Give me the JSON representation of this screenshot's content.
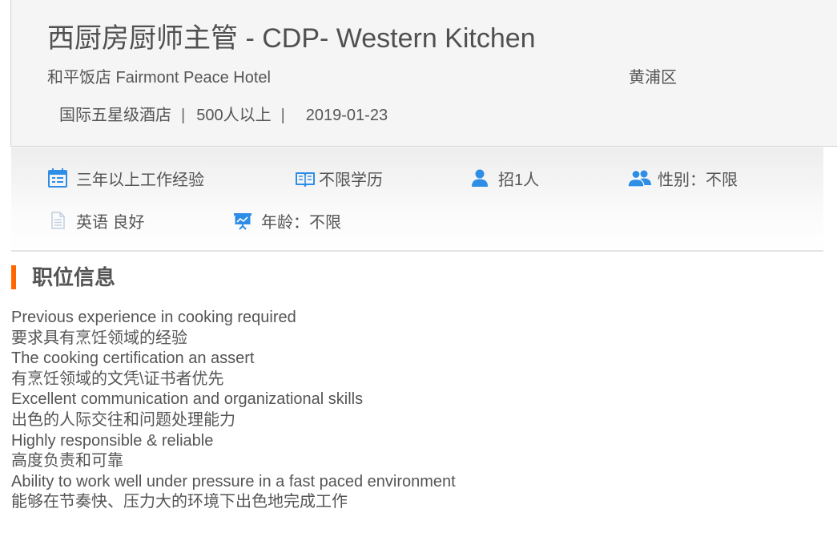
{
  "job": {
    "title": "西厨房厨师主管 - CDP- Western Kitchen",
    "company": "和平饭店 Fairmont Peace Hotel",
    "district": "黄浦区",
    "company_type": "国际五星级酒店",
    "company_size": "500人以上",
    "post_date": "2019-01-23",
    "separator": "|"
  },
  "requirements": [
    {
      "icon": "calendar-icon",
      "text": "三年以上工作经验"
    },
    {
      "icon": "book-icon",
      "text": "不限学历"
    },
    {
      "icon": "person-icon",
      "text": "招1人"
    },
    {
      "icon": "people-icon",
      "text": "性别：不限"
    },
    {
      "icon": "document-icon",
      "text": "英语 良好"
    },
    {
      "icon": "presentation-icon",
      "text": "年龄：不限"
    }
  ],
  "section": {
    "title": "职位信息"
  },
  "description": [
    "Previous experience in cooking required",
    "要求具有烹饪领域的经验",
    "The cooking certification an assert",
    "有烹饪领域的文凭\\证书者优先",
    "Excellent communication and organizational skills",
    "出色的人际交往和问题处理能力",
    "Highly responsible & reliable",
    "高度负责和可靠",
    "Ability to work well under pressure in a fast paced environment",
    "能够在节奏快、压力大的环境下出色地完成工作"
  ],
  "colors": {
    "accent": "#ff6600",
    "icon_blue": "#2e8ee6",
    "text": "#555555"
  }
}
